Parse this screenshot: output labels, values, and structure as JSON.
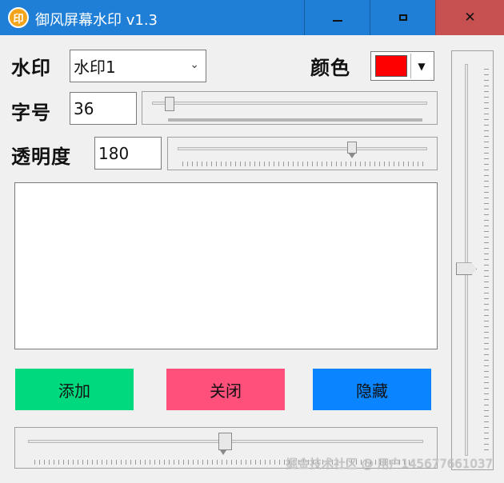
{
  "window": {
    "icon_text": "印",
    "title": "御风屏幕水印 v1.3",
    "min_icon": "minimize-icon",
    "max_icon": "maximize-icon",
    "close_icon": "close-icon",
    "close_glyph": "✕"
  },
  "labels": {
    "watermark": "水印",
    "color": "颜色",
    "font_size": "字号",
    "opacity": "透明度"
  },
  "controls": {
    "watermark_select": "水印1",
    "dropdown_icon": "chevron-down-icon",
    "color_value": "#ff0000",
    "font_size_value": "36",
    "font_size_slider_fraction": 0.03,
    "opacity_value": "180",
    "opacity_slider_fraction": 0.7,
    "bottom_slider_fraction": 0.49,
    "vertical_slider_fraction": 0.53,
    "watermark_text": ""
  },
  "buttons": {
    "add": "添加",
    "close": "关闭",
    "hide": "隐藏",
    "add_color": "#00d97e",
    "close_color": "#ff4f7b",
    "hide_color": "#0a84ff"
  },
  "overlay_watermark": "掘金技术社区 @ 用户145677661037"
}
